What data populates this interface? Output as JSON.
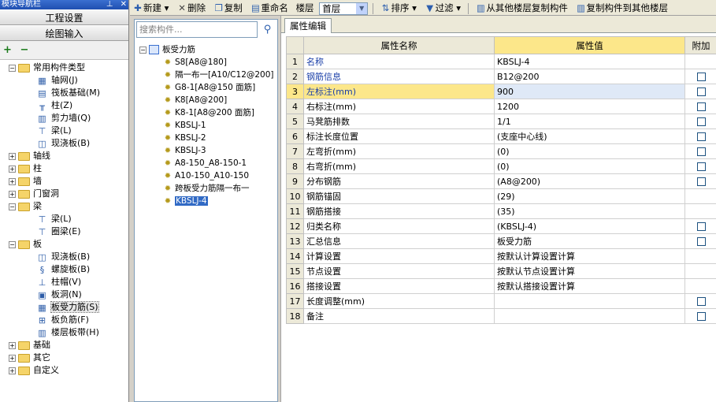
{
  "nav": {
    "title": "模块导航栏",
    "title_pin": "⊥",
    "title_close": "✕",
    "section_project": "工程设置",
    "section_draw": "绘图输入",
    "tool_add": "+",
    "tool_remove": "−",
    "tree": [
      {
        "label": "常用构件类型",
        "level": 0,
        "exp": "−",
        "folder": true
      },
      {
        "label": "轴网(J)",
        "level": 1,
        "icon": "grid-icon"
      },
      {
        "label": "筏板基础(M)",
        "level": 1,
        "icon": "raft-foundation-icon"
      },
      {
        "label": "柱(Z)",
        "level": 1,
        "icon": "column-icon"
      },
      {
        "label": "剪力墙(Q)",
        "level": 1,
        "icon": "shear-wall-icon"
      },
      {
        "label": "梁(L)",
        "level": 1,
        "icon": "beam-icon"
      },
      {
        "label": "现浇板(B)",
        "level": 1,
        "icon": "slab-icon"
      },
      {
        "label": "轴线",
        "level": 0,
        "exp": "+",
        "folder": true
      },
      {
        "label": "柱",
        "level": 0,
        "exp": "+",
        "folder": true
      },
      {
        "label": "墙",
        "level": 0,
        "exp": "+",
        "folder": true
      },
      {
        "label": "门窗洞",
        "level": 0,
        "exp": "+",
        "folder": true
      },
      {
        "label": "梁",
        "level": 0,
        "exp": "−",
        "folder": true
      },
      {
        "label": "梁(L)",
        "level": 1,
        "icon": "beam-icon"
      },
      {
        "label": "圈梁(E)",
        "level": 1,
        "icon": "ring-beam-icon"
      },
      {
        "label": "板",
        "level": 0,
        "exp": "−",
        "folder": true
      },
      {
        "label": "现浇板(B)",
        "level": 1,
        "icon": "slab-icon"
      },
      {
        "label": "螺旋板(B)",
        "level": 1,
        "icon": "spiral-slab-icon"
      },
      {
        "label": "柱帽(V)",
        "level": 1,
        "icon": "column-cap-icon"
      },
      {
        "label": "板洞(N)",
        "level": 1,
        "icon": "slab-hole-icon"
      },
      {
        "label": "板受力筋(S)",
        "level": 1,
        "icon": "slab-rebar-icon",
        "selected": true
      },
      {
        "label": "板负筋(F)",
        "level": 1,
        "icon": "negative-rebar-icon"
      },
      {
        "label": "楼层板带(H)",
        "level": 1,
        "icon": "slab-strip-icon"
      },
      {
        "label": "基础",
        "level": 0,
        "exp": "+",
        "folder": true
      },
      {
        "label": "其它",
        "level": 0,
        "exp": "+",
        "folder": true
      },
      {
        "label": "自定义",
        "level": 0,
        "exp": "+",
        "folder": true
      }
    ]
  },
  "toolbar": {
    "new": "新建",
    "delete": "删除",
    "copy": "复制",
    "rename": "重命名",
    "floor_label": "楼层",
    "floor_value": "首层",
    "sort": "排序",
    "filter": "过滤",
    "copy_from_floor": "从其他楼层复制构件",
    "copy_to_floor": "复制构件到其他楼层"
  },
  "components": {
    "search_placeholder": "搜索构件...",
    "root": "板受力筋",
    "items": [
      "S8[A8@180]",
      "隔一布一[A10/C12@200]",
      "G8-1[A8@150 面筋]",
      "K8[A8@200]",
      "K8-1[A8@200 面筋]",
      "KBSLJ-1",
      "KBSLJ-2",
      "KBSLJ-3",
      "A8-150_A8-150-1",
      "A10-150_A10-150",
      "跨板受力筋隔一布一",
      "KBSLJ-4"
    ],
    "selected_index": 11
  },
  "props": {
    "tab": "属性编辑",
    "col_name": "属性名称",
    "col_value": "属性值",
    "col_extra": "附加",
    "rows": [
      {
        "n": "1",
        "name": "名称",
        "value": "KBSLJ-4",
        "link": true,
        "check": false
      },
      {
        "n": "2",
        "name": "钢筋信息",
        "value": "B12@200",
        "link": true,
        "check": true
      },
      {
        "n": "3",
        "name": "左标注(mm)",
        "value": "900",
        "link": true,
        "check": true,
        "active": true
      },
      {
        "n": "4",
        "name": "右标注(mm)",
        "value": "1200",
        "link": false,
        "check": true
      },
      {
        "n": "5",
        "name": "马凳筋排数",
        "value": "1/1",
        "link": false,
        "check": true
      },
      {
        "n": "6",
        "name": "标注长度位置",
        "value": "(支座中心线)",
        "link": false,
        "check": true
      },
      {
        "n": "7",
        "name": "左弯折(mm)",
        "value": "(0)",
        "link": false,
        "check": true
      },
      {
        "n": "8",
        "name": "右弯折(mm)",
        "value": "(0)",
        "link": false,
        "check": true
      },
      {
        "n": "9",
        "name": "分布钢筋",
        "value": "(A8@200)",
        "link": false,
        "check": true
      },
      {
        "n": "10",
        "name": "钢筋锚固",
        "value": "(29)",
        "link": false,
        "check": false
      },
      {
        "n": "11",
        "name": "钢筋搭接",
        "value": "(35)",
        "link": false,
        "check": false
      },
      {
        "n": "12",
        "name": "归类名称",
        "value": "(KBSLJ-4)",
        "link": false,
        "check": true
      },
      {
        "n": "13",
        "name": "汇总信息",
        "value": "板受力筋",
        "link": false,
        "check": true
      },
      {
        "n": "14",
        "name": "计算设置",
        "value": "按默认计算设置计算",
        "link": false,
        "check": false
      },
      {
        "n": "15",
        "name": "节点设置",
        "value": "按默认节点设置计算",
        "link": false,
        "check": false
      },
      {
        "n": "16",
        "name": "搭接设置",
        "value": "按默认搭接设置计算",
        "link": false,
        "check": false
      },
      {
        "n": "17",
        "name": "长度调整(mm)",
        "value": "",
        "link": false,
        "check": true
      },
      {
        "n": "18",
        "name": "备注",
        "value": "",
        "link": false,
        "check": true
      }
    ]
  }
}
